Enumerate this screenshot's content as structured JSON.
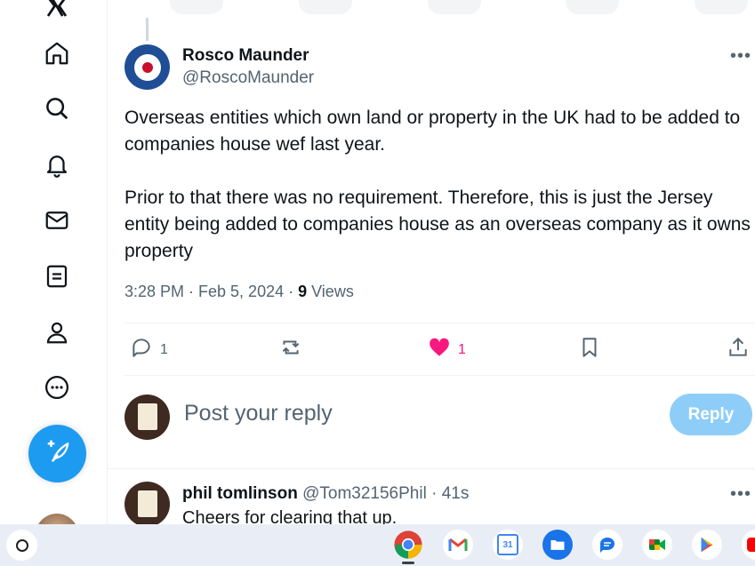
{
  "nav": {
    "items": [
      {
        "name": "x-logo-icon"
      },
      {
        "name": "home-icon"
      },
      {
        "name": "search-icon"
      },
      {
        "name": "notifications-icon"
      },
      {
        "name": "messages-icon"
      },
      {
        "name": "lists-icon"
      },
      {
        "name": "profile-icon"
      },
      {
        "name": "more-icon"
      }
    ],
    "compose_icon": "feather-plus-icon"
  },
  "tweet": {
    "author_name": "Rosco Maunder",
    "author_handle": "@RoscoMaunder",
    "paragraph1": "Overseas entities which own land or property in the UK had to be added to companies house wef last year.",
    "paragraph2": "Prior to that there was no requirement. Therefore, this is just the Jersey entity being added to companies house as an overseas company as it owns property",
    "time": "3:28 PM · Feb 5, 2024 · ",
    "views_count": "9",
    "views_label": " Views",
    "replies": "1",
    "likes": "1",
    "like_color": "#f91880"
  },
  "reply_box": {
    "placeholder": "Post your reply",
    "button": "Reply"
  },
  "reply": {
    "name": "phil tomlinson",
    "handle_time": " @Tom32156Phil · 41s",
    "text": "Cheers for clearing that up."
  },
  "shelf": {
    "apps": [
      "chrome-icon",
      "gmail-icon",
      "calendar-icon",
      "files-icon",
      "messages-app-icon",
      "meet-icon",
      "play-store-icon",
      "youtube-icon"
    ],
    "calendar_day": "31"
  }
}
